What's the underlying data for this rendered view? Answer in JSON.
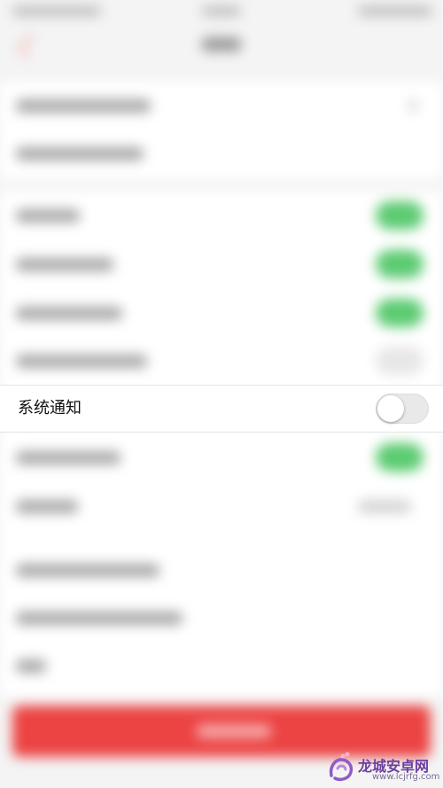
{
  "settings": {
    "focused_row": {
      "label": "系统通知",
      "toggle_on": false
    }
  },
  "watermark": {
    "name": "龙城安卓网",
    "url": "www.lcjrfg.com",
    "logo_icon": "lc-logo-icon"
  },
  "colors": {
    "toggle_on": "#5ccb72",
    "primary_button": "#ec4343",
    "watermark": "#6a3fa0"
  }
}
